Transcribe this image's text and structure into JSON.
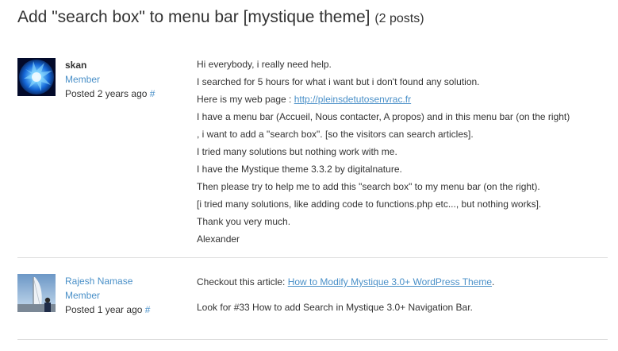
{
  "topic": {
    "title": "Add \"search box\" to menu bar [mystique theme]",
    "post_count": "(2 posts)"
  },
  "posts": [
    {
      "author": "skan",
      "role": "Member",
      "posted_prefix": "Posted",
      "posted_time": "2 years ago",
      "permalink": "#",
      "avatar_icon": "blue-splash-avatar",
      "lines": [
        "Hi everybody, i really need help.",
        "I searched for 5 hours for what i want but i don't found any solution.",
        "Here is my web page : ",
        "I have a menu bar (Accueil, Nous contacter, A propos) and in this menu bar (on the right)",
        ", i want to add a \"search box\". [so the visitors can search articles].",
        "I tried many solutions but nothing work with me.",
        "I have the Mystique theme 3.3.2 by digitalnature.",
        "Then please try to help me to add this \"search box\" to my menu bar (on the right).",
        "[i tried many solutions, like adding code to functions.php etc..., but nothing works].",
        "Thank you very much.",
        "Alexander"
      ],
      "link_text": "http://pleinsdetutosenvrac.fr"
    },
    {
      "author": "Rajesh Namase",
      "role": "Member",
      "posted_prefix": "Posted",
      "posted_time": "1 year ago",
      "permalink": "#",
      "avatar_icon": "burj-al-arab-avatar",
      "line1_prefix": "Checkout this article: ",
      "line1_link": "How to Modify Mystique 3.0+ WordPress Theme",
      "line1_suffix": ".",
      "line2": "Look for #33 How to add Search in Mystique 3.0+ Navigation Bar."
    }
  ],
  "colors": {
    "link": "#4a90c8",
    "text": "#333333",
    "divider": "#dddddd"
  }
}
